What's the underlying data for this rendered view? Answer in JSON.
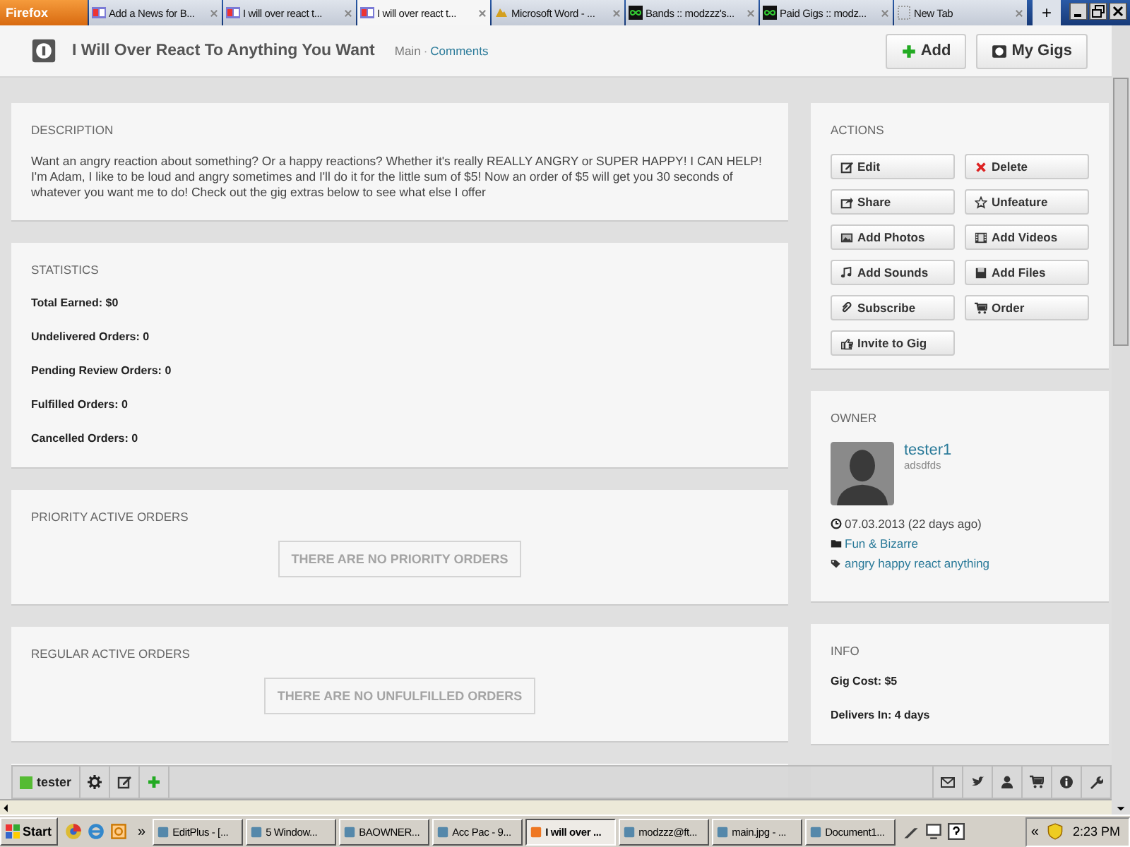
{
  "browser": {
    "menu_button": "Firefox",
    "tabs": [
      {
        "label": "Add a News for B...",
        "selected": false,
        "kind": "page"
      },
      {
        "label": "I will over react t...",
        "selected": false,
        "kind": "page"
      },
      {
        "label": "I will over react t...",
        "selected": true,
        "kind": "page"
      },
      {
        "label": "Microsoft Word - ...",
        "selected": false,
        "kind": "word"
      },
      {
        "label": "Bands :: modzzz's...",
        "selected": false,
        "kind": "loop"
      },
      {
        "label": "Paid Gigs :: modz...",
        "selected": false,
        "kind": "loop"
      },
      {
        "label": "New Tab",
        "selected": false,
        "kind": "blank"
      }
    ],
    "new_tab": "+"
  },
  "header": {
    "title": "I Will Over React To Anything You Want",
    "breadcrumb": [
      "Main",
      "Comments"
    ],
    "separator": "·",
    "buttons": [
      {
        "label": "Add",
        "kind": "add"
      },
      {
        "label": "My Gigs",
        "kind": "gigs"
      }
    ]
  },
  "description": {
    "heading": "DESCRIPTION",
    "text": "Want an angry reaction about something? Or a happy reactions? Whether it's really REALLY ANGRY or SUPER HAPPY! I CAN HELP! I'm Adam, I like to be loud and angry sometimes and I'll do it for the little sum of $5! Now an order of $5 will get you 30 seconds of whatever you want me to do! Check out the gig extras below to see what else I offer"
  },
  "statistics": {
    "heading": "STATISTICS",
    "items": [
      "Total Earned: $0",
      "Undelivered Orders: 0",
      "Pending Review Orders: 0",
      "Fulfilled Orders: 0",
      "Cancelled Orders: 0"
    ]
  },
  "priority_orders": {
    "heading": "PRIORITY ACTIVE ORDERS",
    "empty_message": "THERE ARE NO PRIORITY ORDERS"
  },
  "regular_orders": {
    "heading": "REGULAR ACTIVE ORDERS",
    "empty_message": "THERE ARE NO UNFULFILLED ORDERS"
  },
  "actions": {
    "heading": "ACTIONS",
    "buttons": [
      {
        "label": "Edit",
        "kind": "edit"
      },
      {
        "label": "Delete",
        "kind": "delete"
      },
      {
        "label": "Share",
        "kind": "share"
      },
      {
        "label": "Unfeature",
        "kind": "unfeature"
      },
      {
        "label": "Add Photos",
        "kind": "photos"
      },
      {
        "label": "Add Videos",
        "kind": "videos"
      },
      {
        "label": "Add Sounds",
        "kind": "sounds"
      },
      {
        "label": "Add Files",
        "kind": "files"
      },
      {
        "label": "Subscribe",
        "kind": "subscribe"
      },
      {
        "label": "Order",
        "kind": "order"
      },
      {
        "label": "Invite to Gig",
        "kind": "invite"
      }
    ]
  },
  "owner": {
    "heading": "OWNER",
    "username": "tester1",
    "subtitle": "adsdfds",
    "meta": [
      {
        "kind": "date",
        "text": "07.03.2013 (22 days ago)"
      },
      {
        "kind": "category",
        "text": "Fun & Bizarre"
      },
      {
        "kind": "tags",
        "text": "angry happy react anything"
      }
    ]
  },
  "info": {
    "heading": "INFO",
    "items": [
      "Gig Cost: $5",
      "Delivers In: 4 days"
    ]
  },
  "toolbar": {
    "user": "tester"
  },
  "taskbar": {
    "start": "Start",
    "overflow": "»",
    "items": [
      {
        "label": "EditPlus - [...",
        "selected": false
      },
      {
        "label": "5 Window...",
        "selected": false
      },
      {
        "label": "BAOWNER...",
        "selected": false
      },
      {
        "label": "Acc Pac - 9...",
        "selected": false
      },
      {
        "label": "I will over ...",
        "selected": true
      },
      {
        "label": "modzzz@ft...",
        "selected": false
      },
      {
        "label": "main.jpg - ...",
        "selected": false
      },
      {
        "label": "Document1...",
        "selected": false
      }
    ],
    "tray_toggle": "«",
    "clock": "2:23 PM"
  }
}
